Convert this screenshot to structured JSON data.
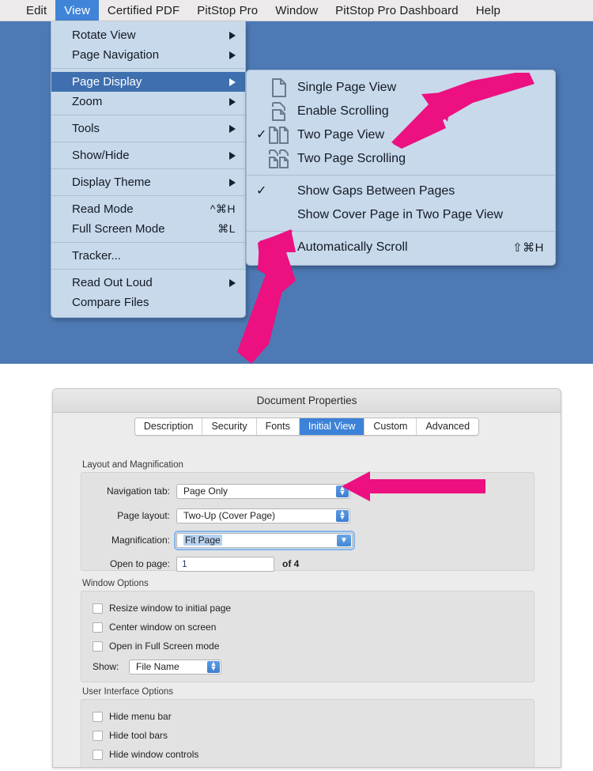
{
  "menubar": {
    "items": [
      {
        "label": "Edit",
        "active": false
      },
      {
        "label": "View",
        "active": true
      },
      {
        "label": "Certified PDF",
        "active": false
      },
      {
        "label": "PitStop Pro",
        "active": false
      },
      {
        "label": "Window",
        "active": false
      },
      {
        "label": "PitStop Pro Dashboard",
        "active": false
      },
      {
        "label": "Help",
        "active": false
      }
    ]
  },
  "view_menu": {
    "items": [
      {
        "label": "Rotate View",
        "submenu": true,
        "shortcut": "",
        "selected": false
      },
      {
        "label": "Page Navigation",
        "submenu": true,
        "shortcut": "",
        "selected": false
      },
      {
        "label": "Page Display",
        "submenu": true,
        "shortcut": "",
        "selected": true
      },
      {
        "label": "Zoom",
        "submenu": true,
        "shortcut": "",
        "selected": false
      },
      {
        "label": "Tools",
        "submenu": true,
        "shortcut": "",
        "selected": false
      },
      {
        "label": "Show/Hide",
        "submenu": true,
        "shortcut": "",
        "selected": false
      },
      {
        "label": "Display Theme",
        "submenu": true,
        "shortcut": "",
        "selected": false
      },
      {
        "label": "Read Mode",
        "submenu": false,
        "shortcut": "^⌘H",
        "selected": false
      },
      {
        "label": "Full Screen Mode",
        "submenu": false,
        "shortcut": "⌘L",
        "selected": false
      },
      {
        "label": "Tracker...",
        "submenu": false,
        "shortcut": "",
        "selected": false
      },
      {
        "label": "Read Out Loud",
        "submenu": true,
        "shortcut": "",
        "selected": false
      },
      {
        "label": "Compare Files",
        "submenu": false,
        "shortcut": "",
        "selected": false
      }
    ]
  },
  "page_display_submenu": {
    "items": [
      {
        "label": "Single Page View",
        "icon": "single-page-icon",
        "checked": false,
        "shortcut": ""
      },
      {
        "label": "Enable Scrolling",
        "icon": "enable-scrolling-icon",
        "checked": false,
        "shortcut": ""
      },
      {
        "label": "Two Page View",
        "icon": "two-page-icon",
        "checked": true,
        "shortcut": ""
      },
      {
        "label": "Two Page Scrolling",
        "icon": "two-page-scrolling-icon",
        "checked": false,
        "shortcut": ""
      },
      {
        "label": "Show Gaps Between Pages",
        "icon": "",
        "checked": true,
        "shortcut": ""
      },
      {
        "label": "Show Cover Page in Two Page View",
        "icon": "",
        "checked": false,
        "shortcut": ""
      },
      {
        "label": "Automatically Scroll",
        "icon": "",
        "checked": false,
        "shortcut": "⇧⌘H"
      }
    ]
  },
  "dialog": {
    "title": "Document Properties",
    "tabs": [
      {
        "label": "Description",
        "active": false
      },
      {
        "label": "Security",
        "active": false
      },
      {
        "label": "Fonts",
        "active": false
      },
      {
        "label": "Initial View",
        "active": true
      },
      {
        "label": "Custom",
        "active": false
      },
      {
        "label": "Advanced",
        "active": false
      }
    ],
    "layout_group": {
      "title": "Layout and Magnification",
      "navigation_tab_label": "Navigation tab:",
      "navigation_tab_value": "Page Only",
      "page_layout_label": "Page layout:",
      "page_layout_value": "Two-Up (Cover Page)",
      "magnification_label": "Magnification:",
      "magnification_value": "Fit Page",
      "open_to_page_label": "Open to page:",
      "open_to_page_value": "1",
      "of_pages": "of 4"
    },
    "window_group": {
      "title": "Window Options",
      "checkboxes": [
        {
          "label": "Resize window to initial page",
          "checked": false
        },
        {
          "label": "Center window on screen",
          "checked": false
        },
        {
          "label": "Open in Full Screen mode",
          "checked": false
        }
      ],
      "show_label": "Show:",
      "show_value": "File Name"
    },
    "ui_group": {
      "title": "User Interface Options",
      "checkboxes": [
        {
          "label": "Hide menu bar",
          "checked": false
        },
        {
          "label": "Hide tool bars",
          "checked": false
        },
        {
          "label": "Hide window controls",
          "checked": false
        }
      ]
    }
  },
  "annotations": {
    "arrow_color": "#ec1080",
    "arrows": [
      {
        "name": "arrow-to-two-page-view"
      },
      {
        "name": "arrow-to-show-cover-page"
      },
      {
        "name": "arrow-to-page-layout"
      }
    ]
  },
  "colors": {
    "menu_background": "#c8d9ec",
    "menu_selection": "#3f6fae",
    "tab_active": "#3c82d8",
    "desktop": "#4d7ab5"
  }
}
